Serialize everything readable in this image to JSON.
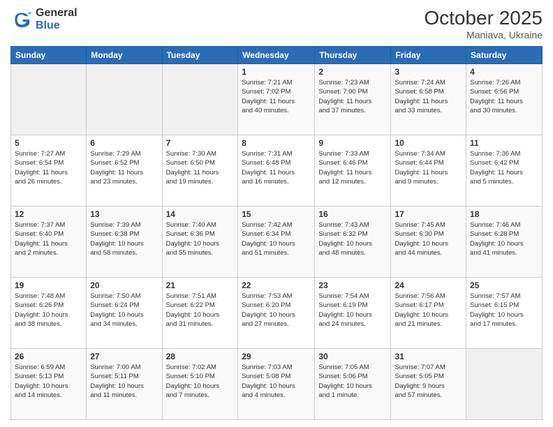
{
  "header": {
    "logo_general": "General",
    "logo_blue": "Blue",
    "month_year": "October 2025",
    "location": "Maniava, Ukraine"
  },
  "weekdays": [
    "Sunday",
    "Monday",
    "Tuesday",
    "Wednesday",
    "Thursday",
    "Friday",
    "Saturday"
  ],
  "weeks": [
    [
      {
        "day": "",
        "info": ""
      },
      {
        "day": "",
        "info": ""
      },
      {
        "day": "",
        "info": ""
      },
      {
        "day": "1",
        "info": "Sunrise: 7:21 AM\nSunset: 7:02 PM\nDaylight: 11 hours\nand 40 minutes."
      },
      {
        "day": "2",
        "info": "Sunrise: 7:23 AM\nSunset: 7:00 PM\nDaylight: 11 hours\nand 37 minutes."
      },
      {
        "day": "3",
        "info": "Sunrise: 7:24 AM\nSunset: 6:58 PM\nDaylight: 11 hours\nand 33 minutes."
      },
      {
        "day": "4",
        "info": "Sunrise: 7:26 AM\nSunset: 6:56 PM\nDaylight: 11 hours\nand 30 minutes."
      }
    ],
    [
      {
        "day": "5",
        "info": "Sunrise: 7:27 AM\nSunset: 6:54 PM\nDaylight: 11 hours\nand 26 minutes."
      },
      {
        "day": "6",
        "info": "Sunrise: 7:29 AM\nSunset: 6:52 PM\nDaylight: 11 hours\nand 23 minutes."
      },
      {
        "day": "7",
        "info": "Sunrise: 7:30 AM\nSunset: 6:50 PM\nDaylight: 11 hours\nand 19 minutes."
      },
      {
        "day": "8",
        "info": "Sunrise: 7:31 AM\nSunset: 6:48 PM\nDaylight: 11 hours\nand 16 minutes."
      },
      {
        "day": "9",
        "info": "Sunrise: 7:33 AM\nSunset: 6:46 PM\nDaylight: 11 hours\nand 12 minutes."
      },
      {
        "day": "10",
        "info": "Sunrise: 7:34 AM\nSunset: 6:44 PM\nDaylight: 11 hours\nand 9 minutes."
      },
      {
        "day": "11",
        "info": "Sunrise: 7:36 AM\nSunset: 6:42 PM\nDaylight: 11 hours\nand 5 minutes."
      }
    ],
    [
      {
        "day": "12",
        "info": "Sunrise: 7:37 AM\nSunset: 6:40 PM\nDaylight: 11 hours\nand 2 minutes."
      },
      {
        "day": "13",
        "info": "Sunrise: 7:39 AM\nSunset: 6:38 PM\nDaylight: 10 hours\nand 58 minutes."
      },
      {
        "day": "14",
        "info": "Sunrise: 7:40 AM\nSunset: 6:36 PM\nDaylight: 10 hours\nand 55 minutes."
      },
      {
        "day": "15",
        "info": "Sunrise: 7:42 AM\nSunset: 6:34 PM\nDaylight: 10 hours\nand 51 minutes."
      },
      {
        "day": "16",
        "info": "Sunrise: 7:43 AM\nSunset: 6:32 PM\nDaylight: 10 hours\nand 48 minutes."
      },
      {
        "day": "17",
        "info": "Sunrise: 7:45 AM\nSunset: 6:30 PM\nDaylight: 10 hours\nand 44 minutes."
      },
      {
        "day": "18",
        "info": "Sunrise: 7:46 AM\nSunset: 6:28 PM\nDaylight: 10 hours\nand 41 minutes."
      }
    ],
    [
      {
        "day": "19",
        "info": "Sunrise: 7:48 AM\nSunset: 6:26 PM\nDaylight: 10 hours\nand 38 minutes."
      },
      {
        "day": "20",
        "info": "Sunrise: 7:50 AM\nSunset: 6:24 PM\nDaylight: 10 hours\nand 34 minutes."
      },
      {
        "day": "21",
        "info": "Sunrise: 7:51 AM\nSunset: 6:22 PM\nDaylight: 10 hours\nand 31 minutes."
      },
      {
        "day": "22",
        "info": "Sunrise: 7:53 AM\nSunset: 6:20 PM\nDaylight: 10 hours\nand 27 minutes."
      },
      {
        "day": "23",
        "info": "Sunrise: 7:54 AM\nSunset: 6:19 PM\nDaylight: 10 hours\nand 24 minutes."
      },
      {
        "day": "24",
        "info": "Sunrise: 7:56 AM\nSunset: 6:17 PM\nDaylight: 10 hours\nand 21 minutes."
      },
      {
        "day": "25",
        "info": "Sunrise: 7:57 AM\nSunset: 6:15 PM\nDaylight: 10 hours\nand 17 minutes."
      }
    ],
    [
      {
        "day": "26",
        "info": "Sunrise: 6:59 AM\nSunset: 5:13 PM\nDaylight: 10 hours\nand 14 minutes."
      },
      {
        "day": "27",
        "info": "Sunrise: 7:00 AM\nSunset: 5:11 PM\nDaylight: 10 hours\nand 11 minutes."
      },
      {
        "day": "28",
        "info": "Sunrise: 7:02 AM\nSunset: 5:10 PM\nDaylight: 10 hours\nand 7 minutes."
      },
      {
        "day": "29",
        "info": "Sunrise: 7:03 AM\nSunset: 5:08 PM\nDaylight: 10 hours\nand 4 minutes."
      },
      {
        "day": "30",
        "info": "Sunrise: 7:05 AM\nSunset: 5:06 PM\nDaylight: 10 hours\nand 1 minute."
      },
      {
        "day": "31",
        "info": "Sunrise: 7:07 AM\nSunset: 5:05 PM\nDaylight: 9 hours\nand 57 minutes."
      },
      {
        "day": "",
        "info": ""
      }
    ]
  ]
}
